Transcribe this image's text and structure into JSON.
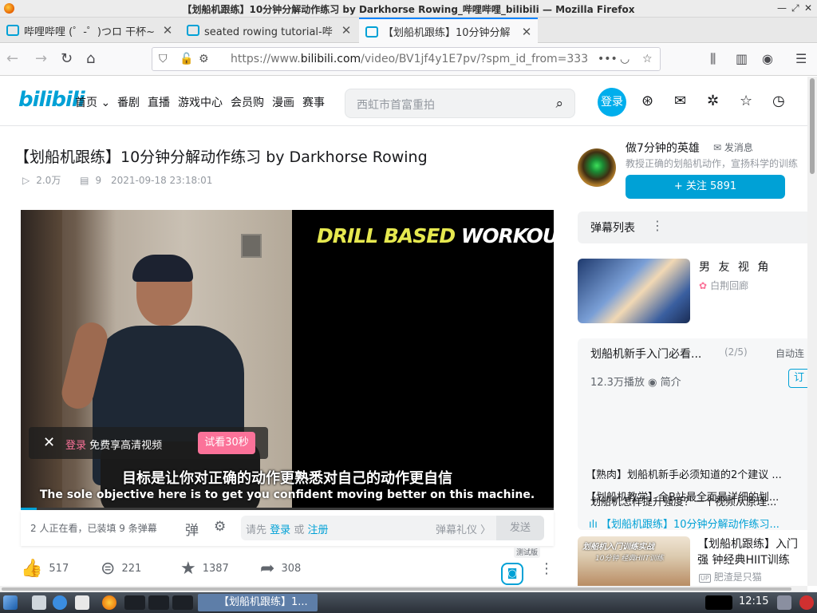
{
  "window": {
    "title": "【划船机跟练】10分钟分解动作练习 by Darkhorse Rowing_哔哩哔哩_bilibili — Mozilla Firefox"
  },
  "tabs": [
    {
      "label": "哔哩哔哩 (゜-゜)つロ 干杯~"
    },
    {
      "label": "seated rowing tutorial-哔"
    },
    {
      "label": "【划船机跟练】10分钟分解"
    }
  ],
  "browser": {
    "url_prefix": "https://www.",
    "url_domain": "bilibili.com",
    "url_suffix": "/video/BV1jf4y1E7pv/?spm_id_from=333"
  },
  "site": {
    "logo": "bilibili",
    "nav": [
      "首页",
      "番剧",
      "直播",
      "游戏中心",
      "会员购",
      "漫画",
      "赛事"
    ],
    "search_placeholder": "西虹市首富重拍",
    "login": "登录"
  },
  "video": {
    "title": "【划船机跟练】10分钟分解动作练习 by Darkhorse Rowing",
    "views": "2.0万",
    "danmaku_count": "9",
    "date": "2021-09-18 23:18:01",
    "banner_left": "DRILL BASED",
    "banner_right": "WORKOUT",
    "subtitle_cn": "目标是让你对正确的动作更熟悉对自己的动作更自信",
    "subtitle_en": "The sole objective here is to get you confident moving better on this machine.",
    "progress_fraction": 0.03,
    "login_popup": {
      "login": "登录",
      "text": "免费享高清视频",
      "trial": "试看30秒"
    }
  },
  "danmaku_bar": {
    "watching": "2 人正在看，已装填 9 条弹幕",
    "placeholder_prefix": "请先",
    "login": "登录",
    "or": "或",
    "register": "注册",
    "gift": "弹幕礼仪 〉",
    "send": "发送"
  },
  "actions": {
    "like": "517",
    "coin": "221",
    "fav": "1387",
    "share": "308",
    "test_tag": "测试版"
  },
  "uploader": {
    "name": "做7分钟的英雄",
    "message": "发消息",
    "description": "教授正确的划船机动作，宣扬科学的训练",
    "follow": "+ 关注 5891"
  },
  "sidebar": {
    "danmaku_list": "弹幕列表",
    "ad": {
      "title": "男 友 视 角",
      "source": "白荆回廊"
    },
    "collection": {
      "title": "划船机新手入门必看...",
      "position": "(2/5)",
      "autoplay": "自动连",
      "stats": "12.3万播放",
      "intro": "简介",
      "subscribe": "订",
      "items": [
        "【划船机教学】全B站最全面最详细的划...",
        "【划船机跟练】10分钟分解动作练习...",
        "【熟肉】划船机新手必须知道的2个建议 ...",
        "划船机怎样提升强度？一个视频从原理..."
      ]
    },
    "recommend": {
      "title": "【划船机跟练】入门强 钟经典HIIT训练",
      "thumb_caption": "划船机入门训练实战",
      "thumb_sub": "10分钟 经典HIIT训练",
      "up": "肥渣是只猫"
    }
  },
  "taskbar": {
    "task": "【划船机跟练】1...",
    "clock": "12:15"
  }
}
